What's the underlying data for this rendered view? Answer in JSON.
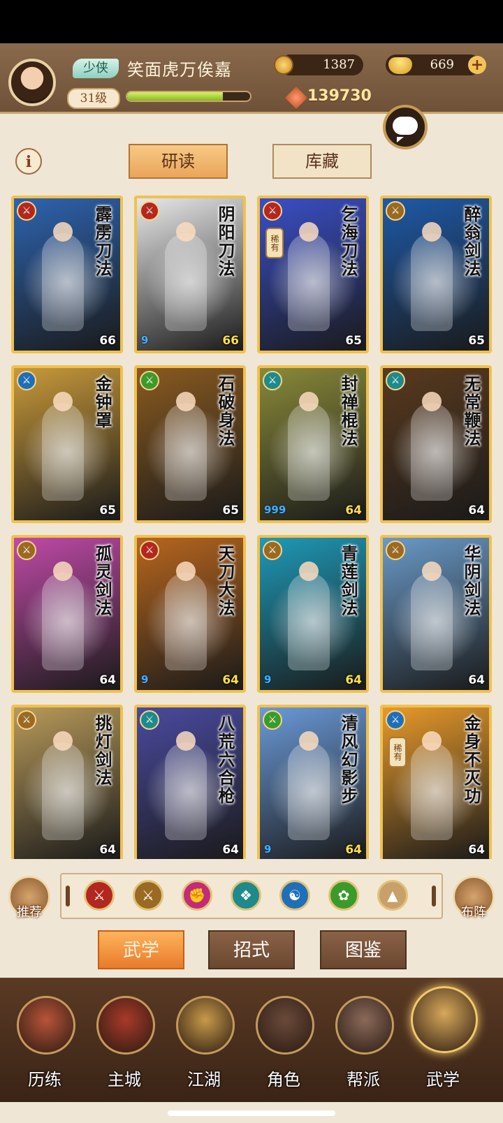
{
  "header": {
    "rank_label": "少侠",
    "player_name": "笑面虎万俟嘉",
    "level": "31级",
    "exp_fraction": 0.78,
    "coins": "1387",
    "ingots": "669",
    "combat_power": "139730"
  },
  "tabs": {
    "study": "研读",
    "storage": "库藏"
  },
  "cards": [
    {
      "name": "霹雳刀法",
      "level": "66",
      "type_color": "#b3271e",
      "art": "#2d64b0",
      "rare": false,
      "tokens": ""
    },
    {
      "name": "阴阳刀法",
      "level": "66",
      "type_color": "#b3271e",
      "art": "#e8e8e8",
      "rare": false,
      "tokens": "9"
    },
    {
      "name": "乞海刀法",
      "level": "65",
      "type_color": "#b3271e",
      "art": "#3a4fc8",
      "rare": true,
      "rare_label": "稀有",
      "tokens": ""
    },
    {
      "name": "醉翁剑法",
      "level": "65",
      "type_color": "#9a6a22",
      "art": "#1e5aa8",
      "rare": false,
      "tokens": ""
    },
    {
      "name": "金钟罩",
      "level": "65",
      "type_color": "#1f6fb8",
      "art": "#c99a3a",
      "rare": false,
      "tokens": ""
    },
    {
      "name": "石破身法",
      "level": "65",
      "type_color": "#3c9a2a",
      "art": "#8a5a20",
      "rare": false,
      "tokens": ""
    },
    {
      "name": "封禅棍法",
      "level": "64",
      "type_color": "#1e8a8a",
      "art": "#8a8a3a",
      "rare": false,
      "tokens": "999"
    },
    {
      "name": "无常鞭法",
      "level": "64",
      "type_color": "#1e8a8a",
      "art": "#5a3a1e",
      "rare": false,
      "tokens": ""
    },
    {
      "name": "孤灵剑法",
      "level": "64",
      "type_color": "#9a6a22",
      "art": "#c04aa8",
      "rare": false,
      "tokens": ""
    },
    {
      "name": "天刀大法",
      "level": "64",
      "type_color": "#b3271e",
      "art": "#b8661e",
      "rare": false,
      "tokens": "9"
    },
    {
      "name": "青莲剑法",
      "level": "64",
      "type_color": "#9a6a22",
      "art": "#1e9ab8",
      "rare": false,
      "tokens": "9"
    },
    {
      "name": "华阴剑法",
      "level": "64",
      "type_color": "#9a6a22",
      "art": "#6a9ac8",
      "rare": false,
      "tokens": ""
    },
    {
      "name": "挑灯剑法",
      "level": "64",
      "type_color": "#9a6a22",
      "art": "#b89a5a",
      "rare": false,
      "tokens": ""
    },
    {
      "name": "八荒六合枪",
      "level": "64",
      "type_color": "#1e8a8a",
      "art": "#4a4aa0",
      "rare": false,
      "tokens": ""
    },
    {
      "name": "清风幻影步",
      "level": "64",
      "type_color": "#3c9a2a",
      "art": "#6a9ad8",
      "rare": false,
      "tokens": "9"
    },
    {
      "name": "金身不灭功",
      "level": "64",
      "type_color": "#1f6fb8",
      "art": "#e89a2a",
      "rare": true,
      "rare_label": "稀有",
      "tokens": ""
    }
  ],
  "filters": [
    {
      "icon": "sword-icon",
      "glyph": "⚔",
      "color": "#b3271e"
    },
    {
      "icon": "sword-gold-icon",
      "glyph": "⚔",
      "color": "#9a6a22"
    },
    {
      "icon": "fist-icon",
      "glyph": "✊",
      "color": "#c42a7a"
    },
    {
      "icon": "fan-icon",
      "glyph": "❖",
      "color": "#1e8a8a"
    },
    {
      "icon": "yinyang-icon",
      "glyph": "☯",
      "color": "#1f6fb8"
    },
    {
      "icon": "swirl-icon",
      "glyph": "✿",
      "color": "#3c9a2a"
    },
    {
      "icon": "arrow-up-icon",
      "glyph": "▲",
      "color": "#c9a06a"
    }
  ],
  "side_buttons": {
    "recommend": "推荐",
    "formation": "布阵"
  },
  "bottom_tabs": {
    "martial_arts": "武学",
    "moves": "招式",
    "codex": "图鉴"
  },
  "nav": [
    {
      "label": "历练",
      "color": "#b8543a"
    },
    {
      "label": "主城",
      "color": "#a83a2a"
    },
    {
      "label": "江湖",
      "color": "#c89a4a"
    },
    {
      "label": "角色",
      "color": "#6a4a3a"
    },
    {
      "label": "帮派",
      "color": "#8a6a5a"
    },
    {
      "label": "武学",
      "color": "#d8a85a"
    }
  ],
  "colors": {
    "accent": "#eaa55a",
    "card_border": "#f1c14e",
    "background": "#efe6d6"
  }
}
